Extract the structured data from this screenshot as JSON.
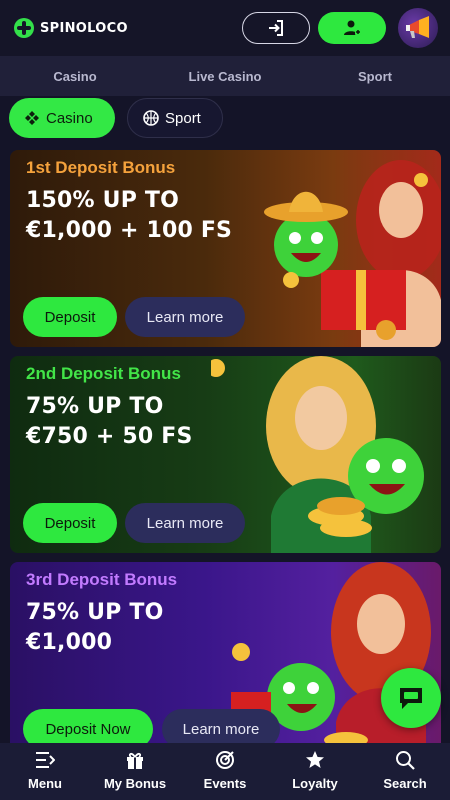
{
  "header": {
    "logo_text": "SPINOLOCO",
    "login_icon": "login-icon",
    "register_icon": "add-user-icon",
    "promo_icon": "megaphone-icon"
  },
  "topnav": {
    "items": [
      {
        "label": "Casino"
      },
      {
        "label": "Live Casino"
      },
      {
        "label": "Sport"
      }
    ]
  },
  "chips": {
    "casino": {
      "label": "Casino",
      "icon": "casino-icon",
      "active": true
    },
    "sport": {
      "label": "Sport",
      "icon": "basketball-icon",
      "active": false
    }
  },
  "cards": [
    {
      "label": "1st Deposit Bonus",
      "title_line1": "150% UP TO",
      "title_line2": "€1,000 + 100 FS",
      "deposit_label": "Deposit",
      "learn_label": "Learn more"
    },
    {
      "label": "2nd Deposit Bonus",
      "title_line1": "75% UP TO",
      "title_line2": "€750 + 50 FS",
      "deposit_label": "Deposit",
      "learn_label": "Learn more"
    },
    {
      "label": "3rd Deposit Bonus",
      "title_line1": "75% UP TO",
      "title_line2": "€1,000",
      "deposit_label": "Deposit Now",
      "learn_label": "Learn more"
    }
  ],
  "chat": {
    "icon": "chat-icon"
  },
  "bottomnav": {
    "items": [
      {
        "label": "Menu",
        "icon": "menu-icon"
      },
      {
        "label": "My Bonus",
        "icon": "gift-icon"
      },
      {
        "label": "Events",
        "icon": "target-icon"
      },
      {
        "label": "Loyalty",
        "icon": "star-icon"
      },
      {
        "label": "Search",
        "icon": "search-icon"
      }
    ]
  },
  "colors": {
    "accent_green": "#2ee83f",
    "background": "#141428",
    "nav_bg": "#202039"
  }
}
